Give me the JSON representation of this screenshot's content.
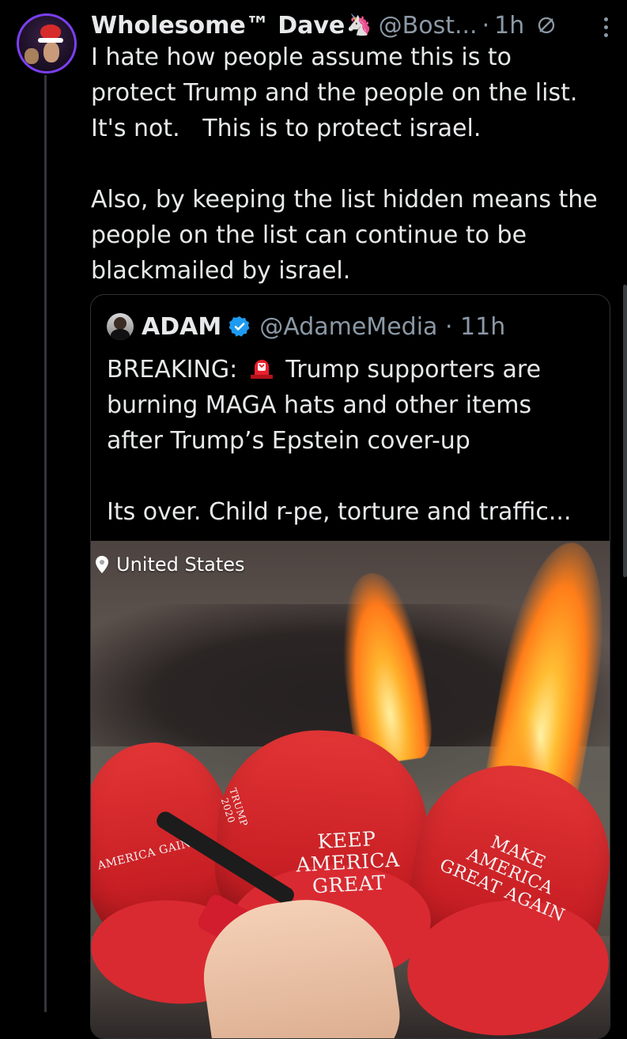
{
  "post": {
    "author": {
      "name": "Wholesome™ Dave",
      "emoji": "🦄",
      "handle": "@Bost...",
      "separator": "·",
      "time": "1h"
    },
    "text": "I hate how people assume this is to\nprotect Trump and the people on the list.\nIt's not.   This is to protect israel.\n\nAlso, by keeping the list hidden means the\npeople on the list can continue to be\nblackmailed by israel.",
    "icons": {
      "mute": "mute-icon",
      "more": "more-icon",
      "avatar": "avatar"
    }
  },
  "quote": {
    "author": {
      "name": "ADAM",
      "handle": "@AdameMedia · 11h"
    },
    "text_before": "BREAKING: ",
    "text_after": " Trump supporters are\nburning MAGA hats and other items\nafter Trump’s Epstein cover-up\n\nIts over. Child r-pe, torture and traffic...",
    "icons": {
      "verified": "verified-icon",
      "siren": "siren-icon"
    },
    "media": {
      "location": "United States",
      "hat_texts": [
        "AMERICA\nGAIN",
        "KEEP\nAMERICA\nGREAT",
        "MAKE AMERICA\nGREAT AGAIN",
        "TRUMP\n2020"
      ]
    }
  },
  "colors": {
    "background": "#000000",
    "text": "#e7e9ea",
    "secondary": "#8b98a5",
    "verified": "#1d9bf0",
    "border": "#2f3336"
  }
}
